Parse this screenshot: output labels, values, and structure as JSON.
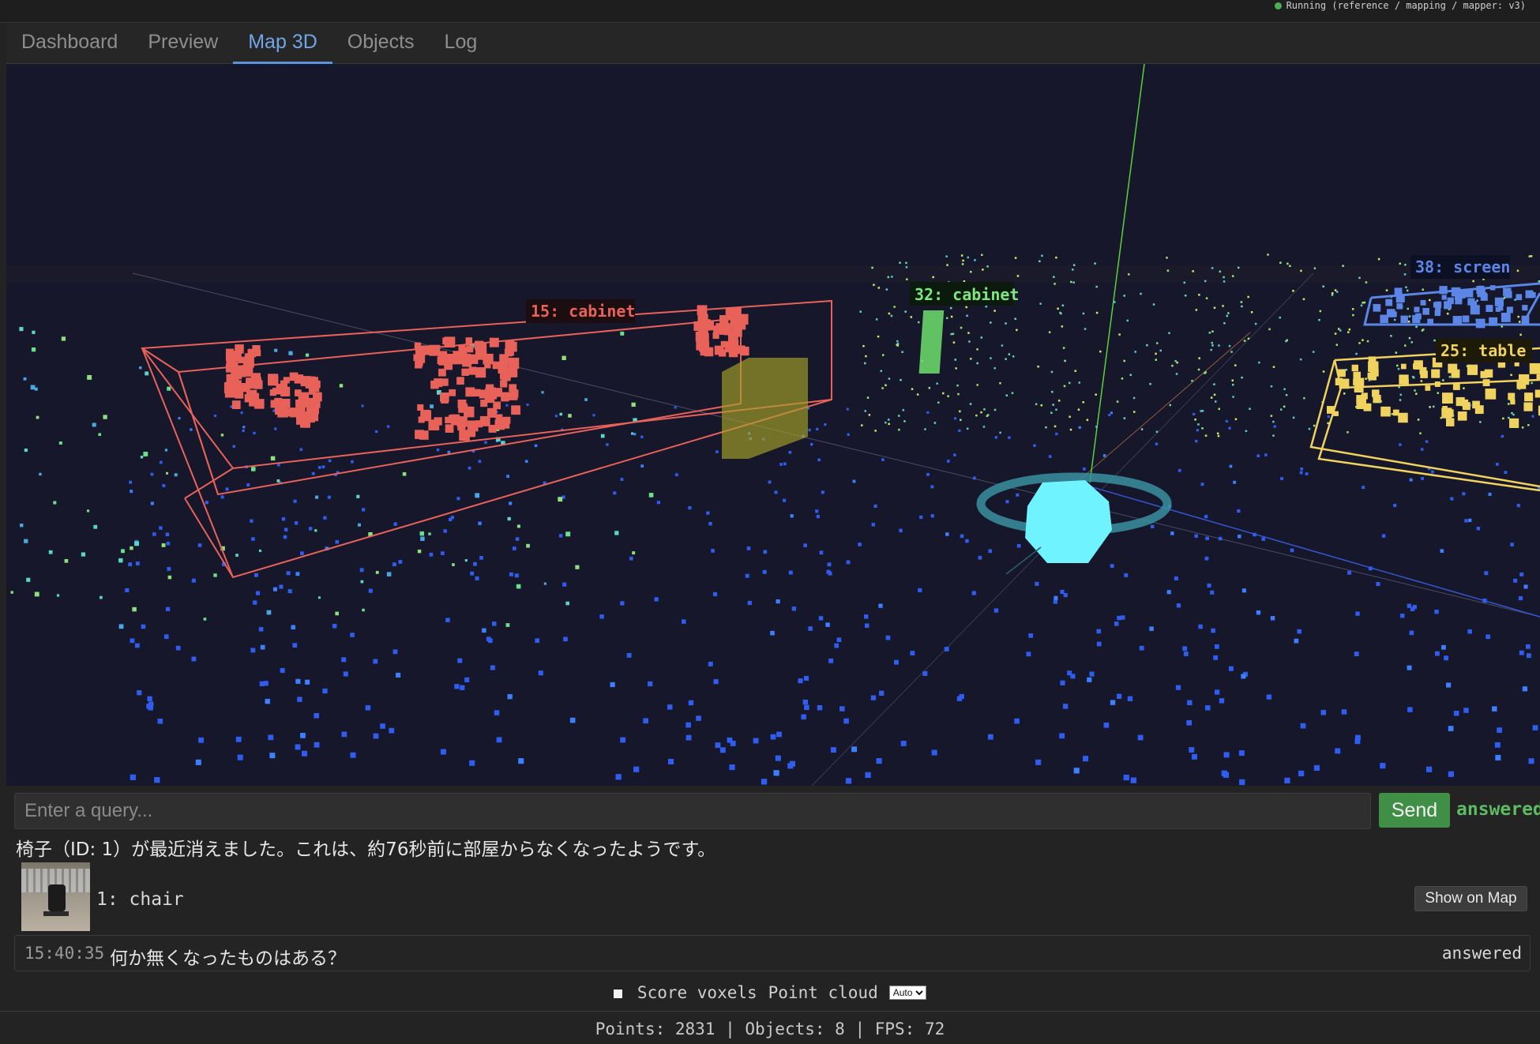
{
  "status": {
    "text": "Running (reference / mapping / mapper: v3)",
    "color": "#4caf50"
  },
  "tabs": [
    {
      "label": "Dashboard",
      "active": false
    },
    {
      "label": "Preview",
      "active": false
    },
    {
      "label": "Map 3D",
      "active": true
    },
    {
      "label": "Objects",
      "active": false
    },
    {
      "label": "Log",
      "active": false
    }
  ],
  "map3d": {
    "background": "#16172a",
    "objects": [
      {
        "label": "15: cabinet",
        "color": "#e8625a"
      },
      {
        "label": "32: cabinet",
        "color": "#7de87d"
      },
      {
        "label": "38: screen",
        "color": "#5b86e6"
      },
      {
        "label": "25: table",
        "color": "#f0d35e"
      }
    ]
  },
  "query": {
    "placeholder": "Enter a query...",
    "value": "",
    "send_label": "Send",
    "status": "answered"
  },
  "answer": "椅子（ID: 1）が最近消えました。これは、約76秒前に部屋からなくなったようです。",
  "result": {
    "label": "1: chair",
    "show_map_label": "Show on Map",
    "thumb_icon": "chair-photo"
  },
  "history": [
    {
      "time": "15:40:35",
      "question": "何か無くなったものはある？",
      "status": "answered"
    }
  ],
  "controls": {
    "score_voxels_label": "Score voxels",
    "point_cloud_label": "Point cloud",
    "point_cloud_options": [
      "Auto"
    ],
    "point_cloud_selected": "Auto"
  },
  "stats": "Points: 2831 | Objects: 8 | FPS: 72"
}
